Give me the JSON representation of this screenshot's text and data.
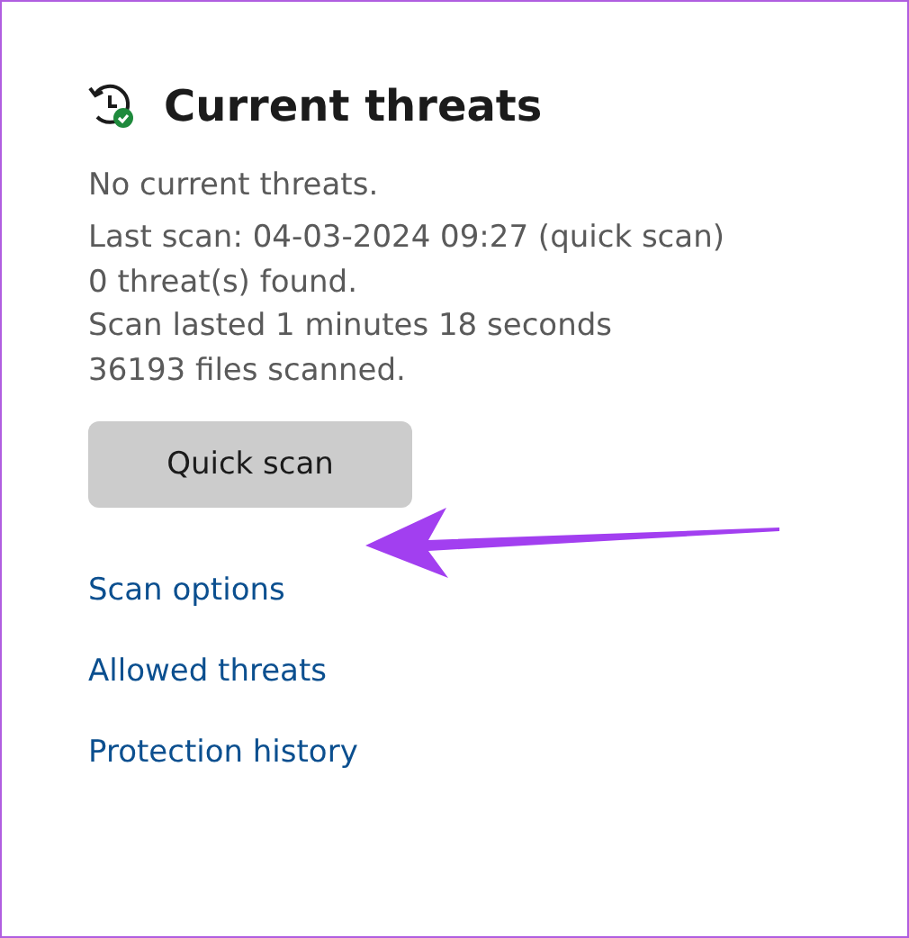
{
  "panel": {
    "title": "Current threats",
    "status": "No current threats.",
    "details": [
      "Last scan: 04-03-2024 09:27 (quick scan)",
      "0 threat(s) found.",
      "Scan lasted 1 minutes 18 seconds",
      "36193 files scanned."
    ],
    "button": {
      "label": "Quick scan"
    },
    "links": [
      "Scan options",
      "Allowed threats",
      "Protection history"
    ]
  }
}
